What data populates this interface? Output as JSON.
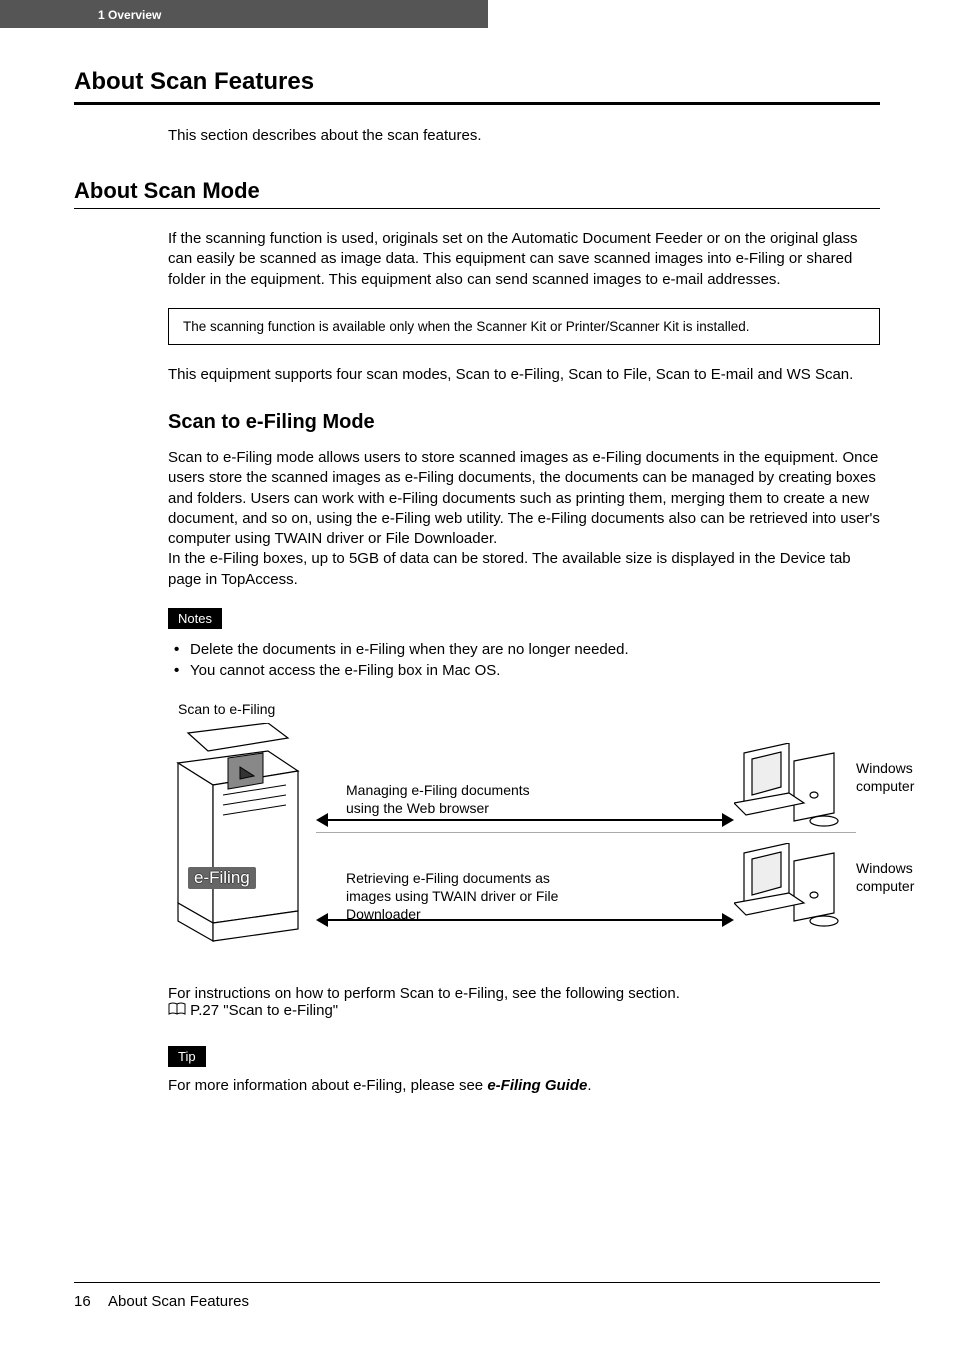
{
  "header": {
    "chapter": "1   Overview"
  },
  "title": "About Scan Features",
  "intro": "This section describes about the scan features.",
  "section": {
    "title": "About Scan Mode",
    "p1": "If the scanning function is used, originals set on the Automatic Document Feeder or on the original glass can easily be scanned as image data.  This equipment can save scanned images into e-Filing or shared folder in the equipment.  This equipment also can send scanned images to e-mail addresses.",
    "note_box": "The scanning function is available only when the Scanner Kit or Printer/Scanner Kit is installed.",
    "p2": "This equipment supports four scan modes, Scan to e-Filing, Scan to File, Scan to E-mail and WS Scan."
  },
  "subsection": {
    "title": "Scan to e-Filing Mode",
    "body": "Scan to e-Filing mode allows users to store scanned images as e-Filing documents in the equipment.  Once users store the scanned images as e-Filing documents, the documents can be managed by creating boxes and folders.  Users can work with e-Filing documents such as printing them, merging them to create a new document, and so on, using the e-Filing web utility.  The e-Filing documents also can be retrieved into user's computer using TWAIN driver or File Downloader.\nIn the e-Filing boxes, up to 5GB of data can be stored.  The available size is displayed in the Device tab page in TopAccess.",
    "notes_label": "Notes",
    "notes": [
      "Delete the documents in e-Filing when they are no longer needed.",
      "You cannot access the e-Filing box in Mac OS."
    ],
    "diagram": {
      "title": "Scan to e-Filing",
      "device_label": "e-Filing",
      "flow1_text": "Managing e-Filing documents using the Web browser",
      "flow1_target": "Windows computer",
      "flow2_text": "Retrieving e-Filing documents as images using TWAIN driver or File Downloader",
      "flow2_target": "Windows computer"
    },
    "instructions_line": "For instructions on how to perform Scan to e-Filing, see the following section.",
    "link_ref": "P.27 \"Scan to e-Filing\"",
    "tip_label": "Tip",
    "tip_text_pre": "For more information about e-Filing, please see ",
    "tip_text_bold": "e-Filing Guide",
    "tip_text_post": "."
  },
  "footer": {
    "page": "16",
    "title": "About Scan Features"
  }
}
